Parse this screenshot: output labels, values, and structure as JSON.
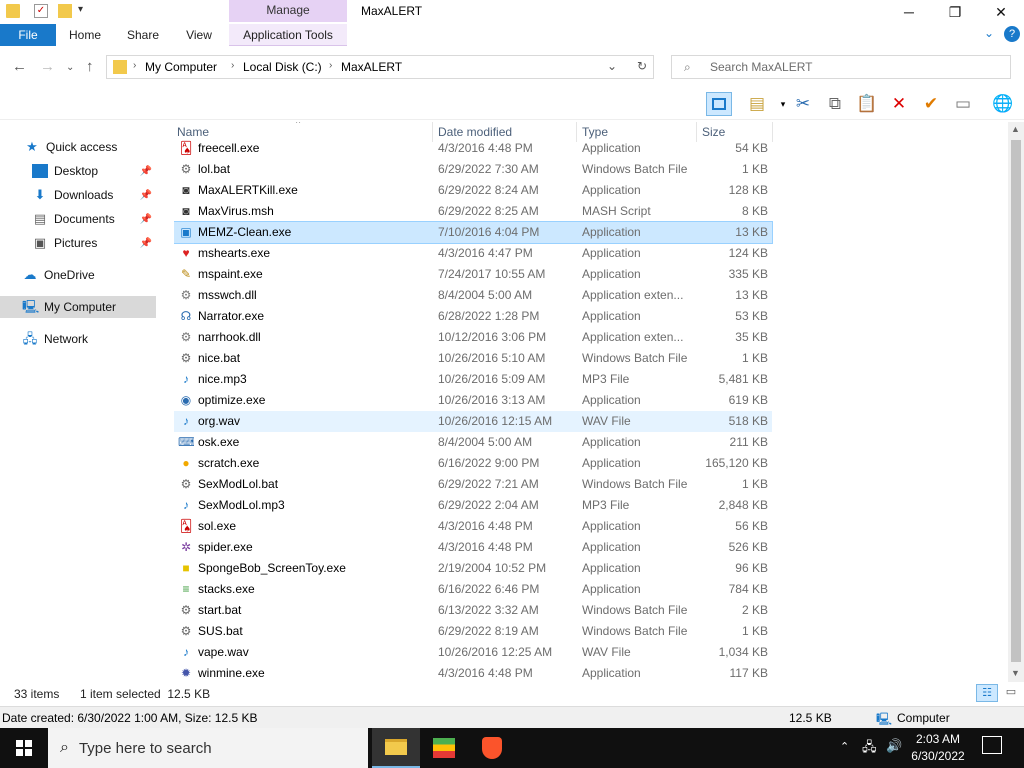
{
  "window": {
    "title": "MaxALERT",
    "minimize": "─",
    "maximize": "❐",
    "close": "✕",
    "help": "?",
    "expand": "⌄"
  },
  "ribbon": {
    "contextual_group": "Manage",
    "tabs": [
      {
        "label": "File"
      },
      {
        "label": "Home"
      },
      {
        "label": "Share"
      },
      {
        "label": "View"
      },
      {
        "label": "Application Tools"
      }
    ]
  },
  "address": {
    "crumbs": [
      "My Computer",
      "Local Disk (C:)",
      "MaxALERT"
    ],
    "search_placeholder": "Search MaxALERT"
  },
  "nav": {
    "items": [
      {
        "label": "Quick access"
      },
      {
        "label": "Desktop"
      },
      {
        "label": "Downloads"
      },
      {
        "label": "Documents"
      },
      {
        "label": "Pictures"
      },
      {
        "label": "OneDrive"
      },
      {
        "label": "My Computer"
      },
      {
        "label": "Network"
      }
    ]
  },
  "columns": {
    "name": "Name",
    "date": "Date modified",
    "type": "Type",
    "size": "Size"
  },
  "files": [
    {
      "name": "freecell.exe",
      "date": "4/3/2016 4:48 PM",
      "type": "Application",
      "size": "54 KB",
      "icon": "cards-icon"
    },
    {
      "name": "lol.bat",
      "date": "6/29/2022 7:30 AM",
      "type": "Windows Batch File",
      "size": "1 KB",
      "icon": "batch-icon"
    },
    {
      "name": "MaxALERTKill.exe",
      "date": "6/29/2022 8:24 AM",
      "type": "Application",
      "size": "128 KB",
      "icon": "app-icon"
    },
    {
      "name": "MaxVirus.msh",
      "date": "6/29/2022 8:25 AM",
      "type": "MASH Script",
      "size": "8 KB",
      "icon": "app-icon"
    },
    {
      "name": "MEMZ-Clean.exe",
      "date": "7/10/2016 4:04 PM",
      "type": "Application",
      "size": "13 KB",
      "icon": "window-icon"
    },
    {
      "name": "mshearts.exe",
      "date": "4/3/2016 4:47 PM",
      "type": "Application",
      "size": "124 KB",
      "icon": "heart-icon"
    },
    {
      "name": "mspaint.exe",
      "date": "7/24/2017 10:55 AM",
      "type": "Application",
      "size": "335 KB",
      "icon": "paint-icon"
    },
    {
      "name": "msswch.dll",
      "date": "8/4/2004 5:00 AM",
      "type": "Application exten...",
      "size": "13 KB",
      "icon": "dll-icon"
    },
    {
      "name": "Narrator.exe",
      "date": "6/28/2022 1:28 PM",
      "type": "Application",
      "size": "53 KB",
      "icon": "narrator-icon"
    },
    {
      "name": "narrhook.dll",
      "date": "10/12/2016 3:06 PM",
      "type": "Application exten...",
      "size": "35 KB",
      "icon": "dll-icon"
    },
    {
      "name": "nice.bat",
      "date": "10/26/2016 5:10 AM",
      "type": "Windows Batch File",
      "size": "1 KB",
      "icon": "batch-icon"
    },
    {
      "name": "nice.mp3",
      "date": "10/26/2016 5:09 AM",
      "type": "MP3 File",
      "size": "5,481 KB",
      "icon": "audio-icon"
    },
    {
      "name": "optimize.exe",
      "date": "10/26/2016 3:13 AM",
      "type": "Application",
      "size": "619 KB",
      "icon": "disc-icon"
    },
    {
      "name": "org.wav",
      "date": "10/26/2016 12:15 AM",
      "type": "WAV File",
      "size": "518 KB",
      "icon": "audio-icon"
    },
    {
      "name": "osk.exe",
      "date": "8/4/2004 5:00 AM",
      "type": "Application",
      "size": "211 KB",
      "icon": "keyboard-icon"
    },
    {
      "name": "scratch.exe",
      "date": "6/16/2022 9:00 PM",
      "type": "Application",
      "size": "165,120 KB",
      "icon": "scratch-icon"
    },
    {
      "name": "SexModLol.bat",
      "date": "6/29/2022 7:21 AM",
      "type": "Windows Batch File",
      "size": "1 KB",
      "icon": "batch-icon"
    },
    {
      "name": "SexModLol.mp3",
      "date": "6/29/2022 2:04 AM",
      "type": "MP3 File",
      "size": "2,848 KB",
      "icon": "audio-icon"
    },
    {
      "name": "sol.exe",
      "date": "4/3/2016 4:48 PM",
      "type": "Application",
      "size": "56 KB",
      "icon": "cards-icon"
    },
    {
      "name": "spider.exe",
      "date": "4/3/2016 4:48 PM",
      "type": "Application",
      "size": "526 KB",
      "icon": "spider-icon"
    },
    {
      "name": "SpongeBob_ScreenToy.exe",
      "date": "2/19/2004 10:52 PM",
      "type": "Application",
      "size": "96 KB",
      "icon": "sponge-icon"
    },
    {
      "name": "stacks.exe",
      "date": "6/16/2022 6:46 PM",
      "type": "Application",
      "size": "784 KB",
      "icon": "stacks-icon"
    },
    {
      "name": "start.bat",
      "date": "6/13/2022 3:32 AM",
      "type": "Windows Batch File",
      "size": "2 KB",
      "icon": "batch-icon"
    },
    {
      "name": "SUS.bat",
      "date": "6/29/2022 8:19 AM",
      "type": "Windows Batch File",
      "size": "1 KB",
      "icon": "batch-icon"
    },
    {
      "name": "vape.wav",
      "date": "10/26/2016 12:25 AM",
      "type": "WAV File",
      "size": "1,034 KB",
      "icon": "audio-icon"
    },
    {
      "name": "winmine.exe",
      "date": "4/3/2016 4:48 PM",
      "type": "Application",
      "size": "117 KB",
      "icon": "mine-icon"
    }
  ],
  "status": {
    "count": "33 items",
    "selected": "1 item selected  12.5 KB"
  },
  "details": {
    "text": "Date created: 6/30/2022 1:00 AM, Size: 12.5 KB",
    "size": "12.5 KB",
    "location": "Computer"
  },
  "taskbar": {
    "search_placeholder": "Type here to search",
    "time": "2:03 AM",
    "date": "6/30/2022"
  },
  "colors": {
    "accent": "#1979ca",
    "selected": "#cce8ff",
    "manage": "#e6d2f4"
  }
}
